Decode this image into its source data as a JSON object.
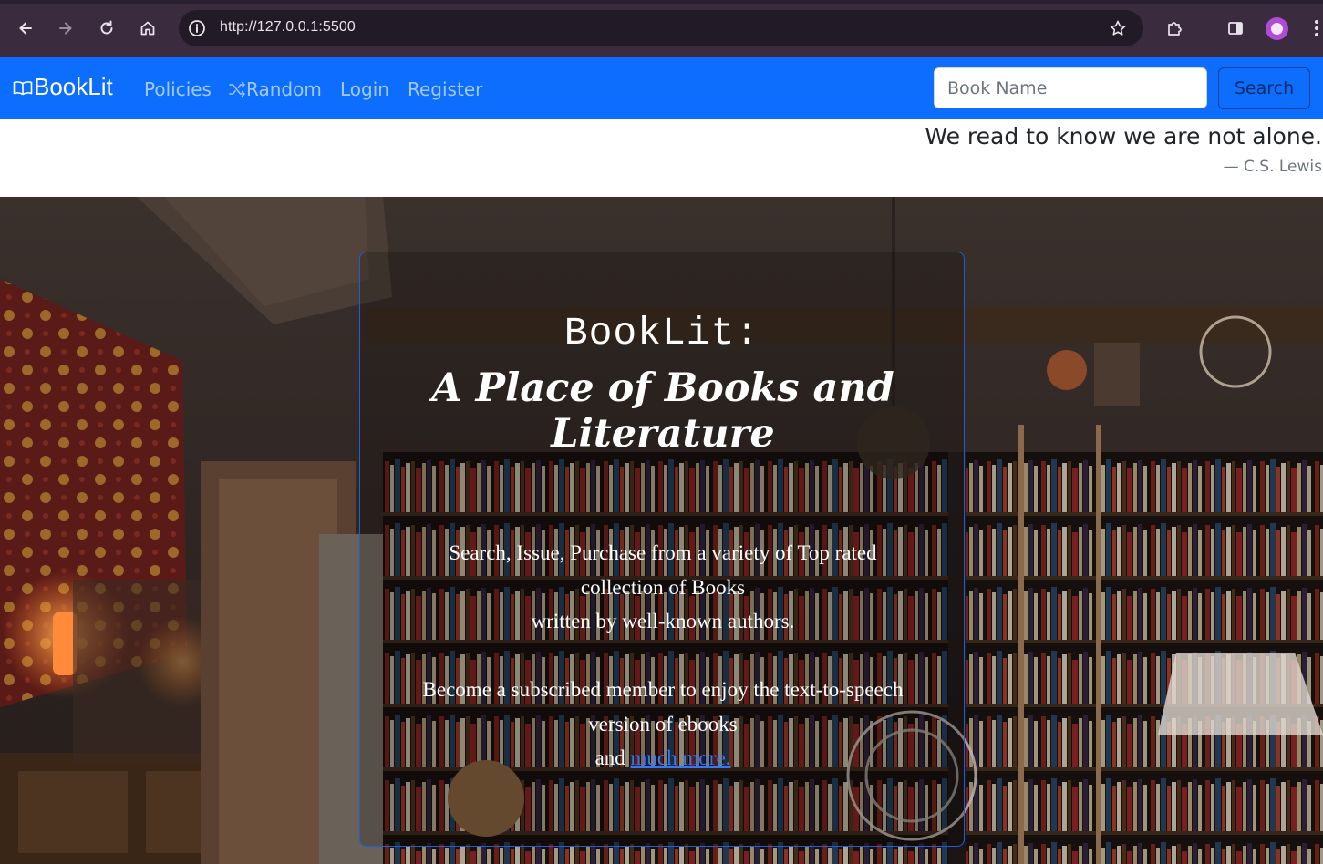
{
  "browser": {
    "url": "http://127.0.0.1:5500"
  },
  "navbar": {
    "brand": "BookLit",
    "links": [
      "Policies",
      "Random",
      "Login",
      "Register"
    ],
    "search_placeholder": "Book Name",
    "search_button": "Search",
    "accent_color": "#0d6efd"
  },
  "quote": {
    "text": "We read to know we are not alone.",
    "author": "—  C.S. Lewis"
  },
  "hero": {
    "title": "BookLit:",
    "subtitle": "A Place of Books and Literature",
    "line1": "Search, Issue, Purchase from a variety of Top rated collection of Books",
    "line2": "written by well-known authors.",
    "line3": "Become a subscribed member to enjoy the text-to-speech version of ebooks",
    "line4_prefix": "and",
    "line4_link": "much more."
  }
}
